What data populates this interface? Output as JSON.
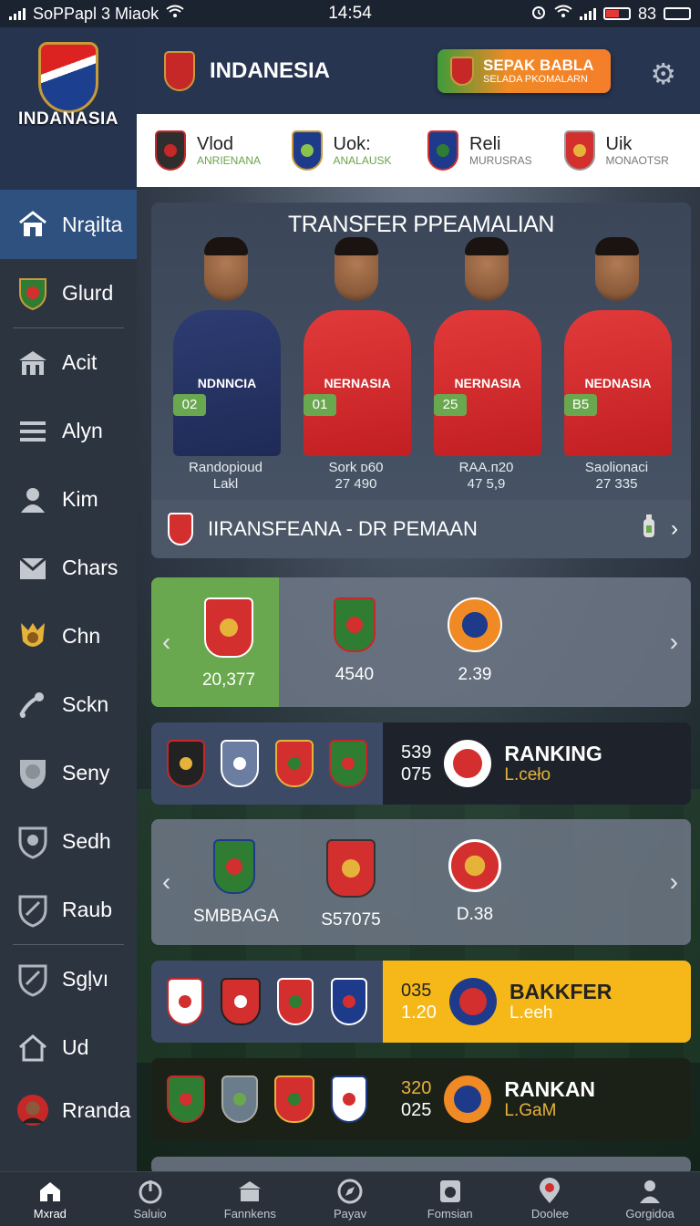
{
  "status_bar": {
    "carrier": "SoPPapl 3 Miaok",
    "time": "14:54",
    "battery": "83"
  },
  "sidebar": {
    "logo_name": "INDANASIA",
    "items": [
      {
        "label": "Nrąilta",
        "icon": "home-icon"
      },
      {
        "label": "Glurd",
        "icon": "club-crest-icon"
      },
      {
        "label": "Acit",
        "icon": "stadium-icon"
      },
      {
        "label": "Alyn",
        "icon": "list-icon"
      },
      {
        "label": "Kim",
        "icon": "person-icon"
      },
      {
        "label": "Chars",
        "icon": "inbox-icon"
      },
      {
        "label": "Chn",
        "icon": "trophy-icon"
      },
      {
        "label": "Sckn",
        "icon": "whistle-icon"
      },
      {
        "label": "Seny",
        "icon": "lion-badge-icon"
      },
      {
        "label": "Sedh",
        "icon": "shield-badge-icon"
      },
      {
        "label": "Raub",
        "icon": "shield-outline-icon"
      },
      {
        "label": "Sgļvı",
        "icon": "shield-check-icon"
      },
      {
        "label": "Ud",
        "icon": "house-outline-icon"
      },
      {
        "label": "Rranda",
        "icon": "avatar-icon"
      }
    ]
  },
  "header": {
    "title": "INDANESIA",
    "cta_title": "SEPAK BABLA",
    "cta_subtitle": "SELADA PKOMALARN"
  },
  "team_strip": [
    {
      "name": "Vlod",
      "sub": "ANRIENANA",
      "color": "#c62828"
    },
    {
      "name": "Uok:",
      "sub": "ANALAUSK",
      "color": "#1e3a8a"
    },
    {
      "name": "Reli",
      "sub": "MURUSRAS",
      "color": "#2e7d32"
    },
    {
      "name": "Uik",
      "sub": "MONAOTSR",
      "color": "#d32f2f"
    }
  ],
  "transfer": {
    "heading": "TRANSFER PPEAMALIAN",
    "players": [
      {
        "shirt": "NDNNCIA",
        "number": "02",
        "caption1": "Randopioud",
        "caption2": "Lakl",
        "kit": "navy"
      },
      {
        "shirt": "NERNASIA",
        "number": "01",
        "caption1": "Sork ᴅ60",
        "caption2": "27 490",
        "kit": "red"
      },
      {
        "shirt": "NERNASIA",
        "number": "25",
        "caption1": "RAA.ᴨ20",
        "caption2": "47 5,9",
        "kit": "red"
      },
      {
        "shirt": "NEDNASIA",
        "number": "B5",
        "caption1": "Saolionaci",
        "caption2": "27 335",
        "kit": "red"
      }
    ],
    "bar_label": "IIRANSFEANA - DR PEMAAN"
  },
  "carousel1": {
    "values": [
      "20,377",
      "4540",
      "2.39"
    ]
  },
  "ranking1": {
    "num1": "539",
    "num2": "075",
    "label": "RANKING",
    "sub": "L.ceło"
  },
  "carousel2": {
    "values": [
      "SMBBAGA",
      "S57075",
      "D.38"
    ]
  },
  "ranking2": {
    "num1": "035",
    "num2": "1.20",
    "label": "BAKKFER",
    "sub": "L.eeh"
  },
  "ranking3": {
    "num1": "320",
    "num2": "025",
    "label": "RANKAN",
    "sub": "L.GaM"
  },
  "bottom_nav": [
    {
      "label": "Mxrad",
      "icon": "home-icon"
    },
    {
      "label": "Saluio",
      "icon": "power-icon"
    },
    {
      "label": "Fannkens",
      "icon": "stadium-icon"
    },
    {
      "label": "Payav",
      "icon": "compass-icon"
    },
    {
      "label": "Fomsian",
      "icon": "camera-icon"
    },
    {
      "label": "Doolee",
      "icon": "location-icon"
    },
    {
      "label": "Gorgidoa",
      "icon": "person-icon"
    }
  ],
  "colors": {
    "accent_green": "#6aa84f",
    "accent_yellow": "#f6b819",
    "header_navy": "#283550",
    "cta_orange": "#f08a24"
  }
}
